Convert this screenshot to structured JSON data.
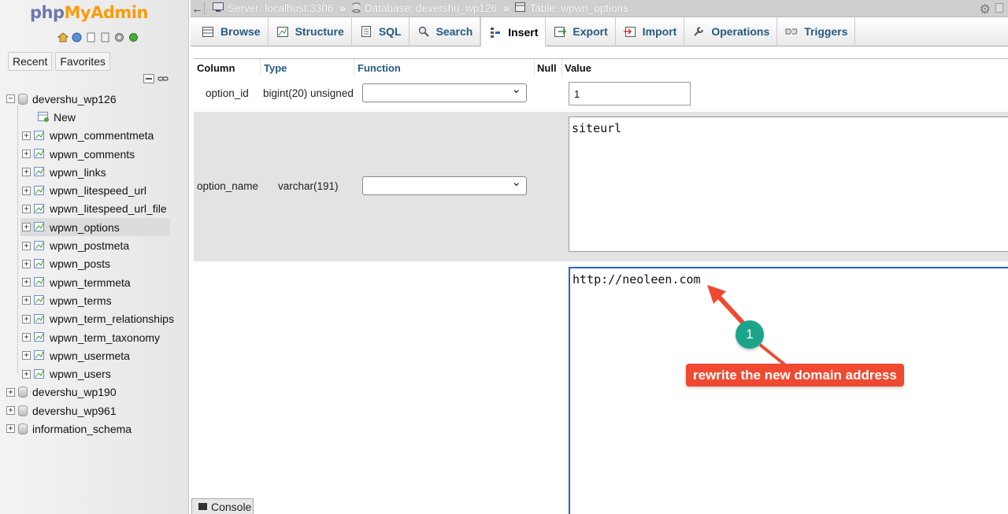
{
  "app": {
    "logo_php": "php",
    "logo_myadmin": "MyAdmin"
  },
  "sidebar": {
    "recent_label": "Recent",
    "favorites_label": "Favorites",
    "databases": [
      {
        "name": "devershu_wp126",
        "expanded": true,
        "children": [
          {
            "label": "New"
          },
          {
            "label": "wpwn_commentmeta"
          },
          {
            "label": "wpwn_comments"
          },
          {
            "label": "wpwn_links"
          },
          {
            "label": "wpwn_litespeed_url"
          },
          {
            "label": "wpwn_litespeed_url_file"
          },
          {
            "label": "wpwn_options",
            "selected": true
          },
          {
            "label": "wpwn_postmeta"
          },
          {
            "label": "wpwn_posts"
          },
          {
            "label": "wpwn_termmeta"
          },
          {
            "label": "wpwn_terms"
          },
          {
            "label": "wpwn_term_relationships"
          },
          {
            "label": "wpwn_term_taxonomy"
          },
          {
            "label": "wpwn_usermeta"
          },
          {
            "label": "wpwn_users"
          }
        ]
      },
      {
        "name": "devershu_wp190",
        "expanded": false
      },
      {
        "name": "devershu_wp961",
        "expanded": false
      },
      {
        "name": "information_schema",
        "expanded": false
      }
    ]
  },
  "breadcrumb": {
    "server": "Server: localhost:3306",
    "database": "Database: devershu_wp126",
    "table": "Table: wpwn_options"
  },
  "tabs": [
    {
      "label": "Browse",
      "icon": "browse-icon"
    },
    {
      "label": "Structure",
      "icon": "structure-icon"
    },
    {
      "label": "SQL",
      "icon": "sql-icon"
    },
    {
      "label": "Search",
      "icon": "search-icon"
    },
    {
      "label": "Insert",
      "icon": "insert-icon",
      "active": true
    },
    {
      "label": "Export",
      "icon": "export-icon"
    },
    {
      "label": "Import",
      "icon": "import-icon"
    },
    {
      "label": "Operations",
      "icon": "wrench-icon"
    },
    {
      "label": "Triggers",
      "icon": "triggers-icon"
    }
  ],
  "insert_form": {
    "headers": {
      "column": "Column",
      "type": "Type",
      "function": "Function",
      "null": "Null",
      "value": "Value"
    },
    "rows": [
      {
        "column": "option_id",
        "type": "bigint(20) unsigned",
        "function": "",
        "value": "1"
      },
      {
        "column": "option_name",
        "type": "varchar(191)",
        "function": "",
        "value": "siteurl"
      },
      {
        "column": "",
        "type": "",
        "function": "",
        "value": "http://neoleen.com"
      }
    ]
  },
  "annotation": {
    "step": "1",
    "text": "rewrite the new domain address",
    "badge_color": "#1aa589",
    "callout_color": "#ef4a31"
  },
  "console_label": "Console",
  "colors": {
    "link": "#235a81",
    "focus_border": "#2a62c4",
    "row_alt": "#e3e3e3"
  }
}
